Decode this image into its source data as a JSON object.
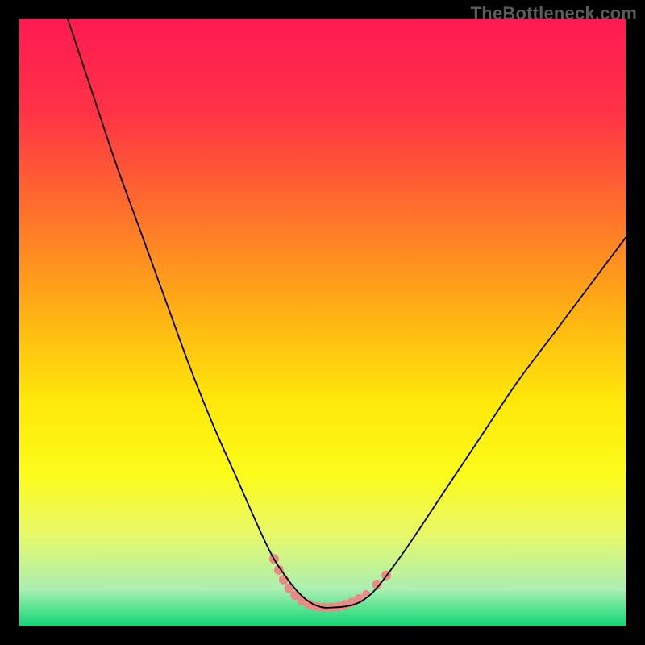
{
  "watermark": "TheBottleneck.com",
  "chart_data": {
    "type": "line",
    "title": "",
    "xlabel": "",
    "ylabel": "",
    "xlim": [
      0,
      100
    ],
    "ylim": [
      0,
      100
    ],
    "grid": false,
    "legend": false,
    "background_gradient_stops": [
      {
        "offset": 0.0,
        "color": "#ff1a52"
      },
      {
        "offset": 0.15,
        "color": "#ff3246"
      },
      {
        "offset": 0.3,
        "color": "#ff6a2e"
      },
      {
        "offset": 0.48,
        "color": "#ffb014"
      },
      {
        "offset": 0.63,
        "color": "#ffe80a"
      },
      {
        "offset": 0.75,
        "color": "#fcfc1a"
      },
      {
        "offset": 0.85,
        "color": "#e7f86a"
      },
      {
        "offset": 0.94,
        "color": "#acefb1"
      },
      {
        "offset": 0.975,
        "color": "#4fe28e"
      },
      {
        "offset": 1.0,
        "color": "#18d47a"
      }
    ],
    "series": [
      {
        "name": "bottleneck-curve",
        "stroke": "#000000",
        "stroke_width": 1.8,
        "x": [
          8,
          12,
          16,
          20,
          24,
          28,
          32,
          36,
          40,
          42,
          44,
          46,
          48,
          50,
          52,
          54,
          56,
          58,
          60,
          64,
          70,
          76,
          82,
          88,
          94,
          100
        ],
        "y": [
          100,
          88,
          76,
          65,
          54,
          43,
          33,
          24,
          15,
          11,
          8,
          5.5,
          3.8,
          3.0,
          3.0,
          3.2,
          3.8,
          5.2,
          7.5,
          13,
          22,
          31,
          40,
          48,
          56,
          64
        ]
      }
    ],
    "markers": {
      "name": "highlight-band",
      "fill": "#e88a86",
      "points": [
        {
          "x": 42.0,
          "y": 11.0,
          "r": 6
        },
        {
          "x": 42.8,
          "y": 9.2,
          "r": 6
        },
        {
          "x": 43.6,
          "y": 7.6,
          "r": 6
        },
        {
          "x": 44.5,
          "y": 6.2,
          "r": 6
        },
        {
          "x": 45.5,
          "y": 5.0,
          "r": 6
        },
        {
          "x": 46.6,
          "y": 4.1,
          "r": 6
        },
        {
          "x": 47.8,
          "y": 3.5,
          "r": 6
        },
        {
          "x": 49.0,
          "y": 3.1,
          "r": 6
        },
        {
          "x": 50.2,
          "y": 3.0,
          "r": 6
        },
        {
          "x": 51.4,
          "y": 3.0,
          "r": 6
        },
        {
          "x": 52.6,
          "y": 3.1,
          "r": 6
        },
        {
          "x": 53.7,
          "y": 3.4,
          "r": 6
        },
        {
          "x": 54.8,
          "y": 3.8,
          "r": 6
        },
        {
          "x": 56.0,
          "y": 4.4,
          "r": 6
        },
        {
          "x": 57.2,
          "y": 5.2,
          "r": 5
        },
        {
          "x": 59.0,
          "y": 6.8,
          "r": 6
        },
        {
          "x": 60.5,
          "y": 8.3,
          "r": 6
        }
      ]
    }
  }
}
